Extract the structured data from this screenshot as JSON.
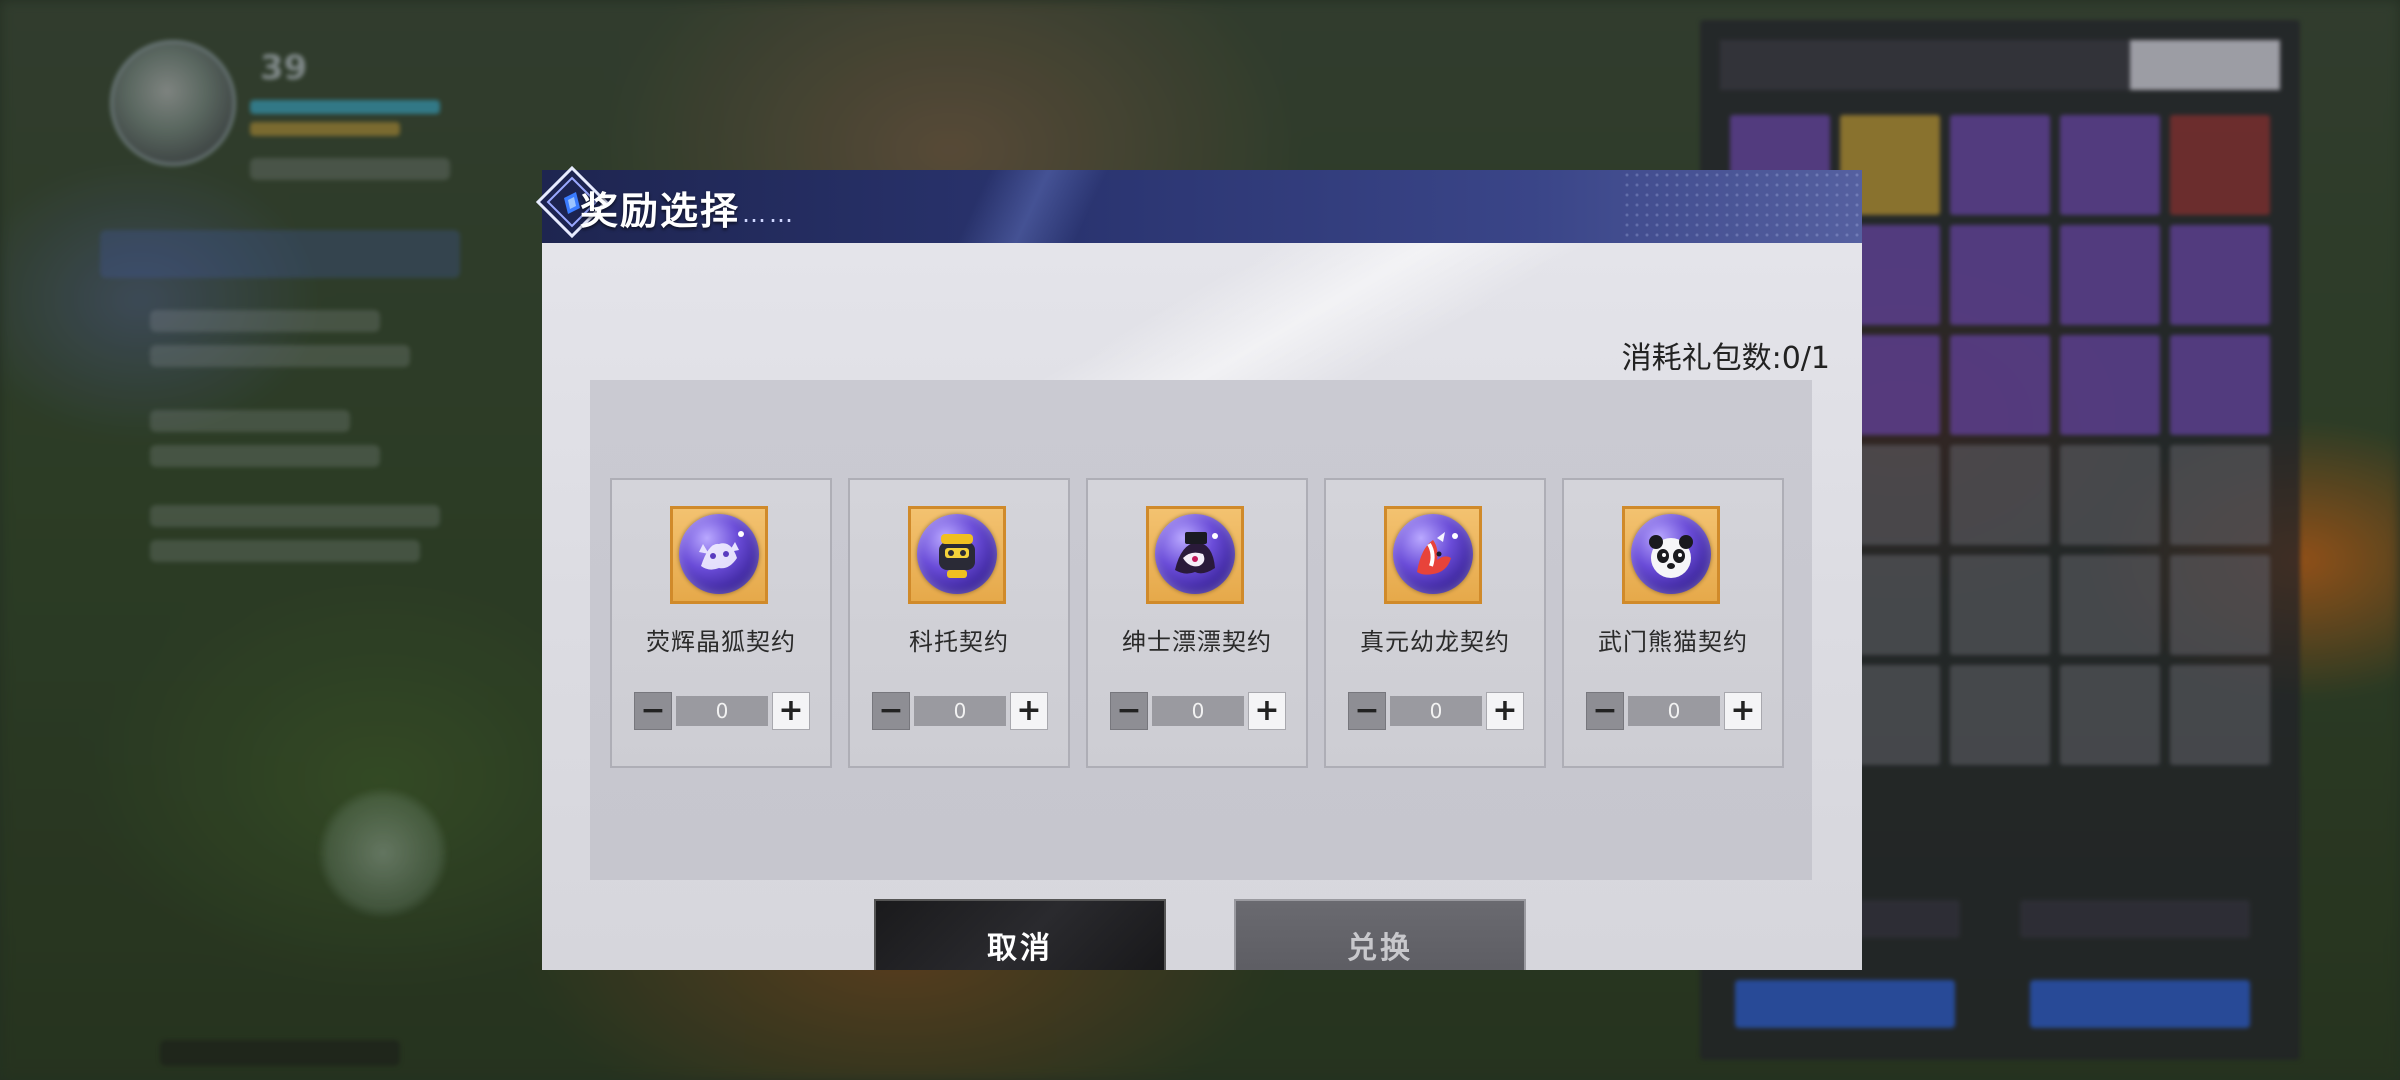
{
  "hud": {
    "level": "39"
  },
  "dialog": {
    "title": "奖励选择",
    "title_dots": "……",
    "counter": "消耗礼包数:0/1",
    "items": [
      {
        "name": "荧辉晶狐契约",
        "qty": "0",
        "icon": "crystal-fox-icon"
      },
      {
        "name": "科托契约",
        "qty": "0",
        "icon": "koto-robot-icon"
      },
      {
        "name": "绅士漂漂契约",
        "qty": "0",
        "icon": "gentleman-piaopiao-icon"
      },
      {
        "name": "真元幼龙契约",
        "qty": "0",
        "icon": "young-dragon-icon"
      },
      {
        "name": "武门熊猫契约",
        "qty": "0",
        "icon": "panda-icon"
      }
    ],
    "minus_symbol": "−",
    "plus_symbol": "+",
    "cancel_label": "取消",
    "exchange_label": "兑换"
  },
  "colors": {
    "header_navy": "#2a3470",
    "item_frame_gold": "#e6a94a",
    "orb_purple": "#6a4cd8"
  }
}
